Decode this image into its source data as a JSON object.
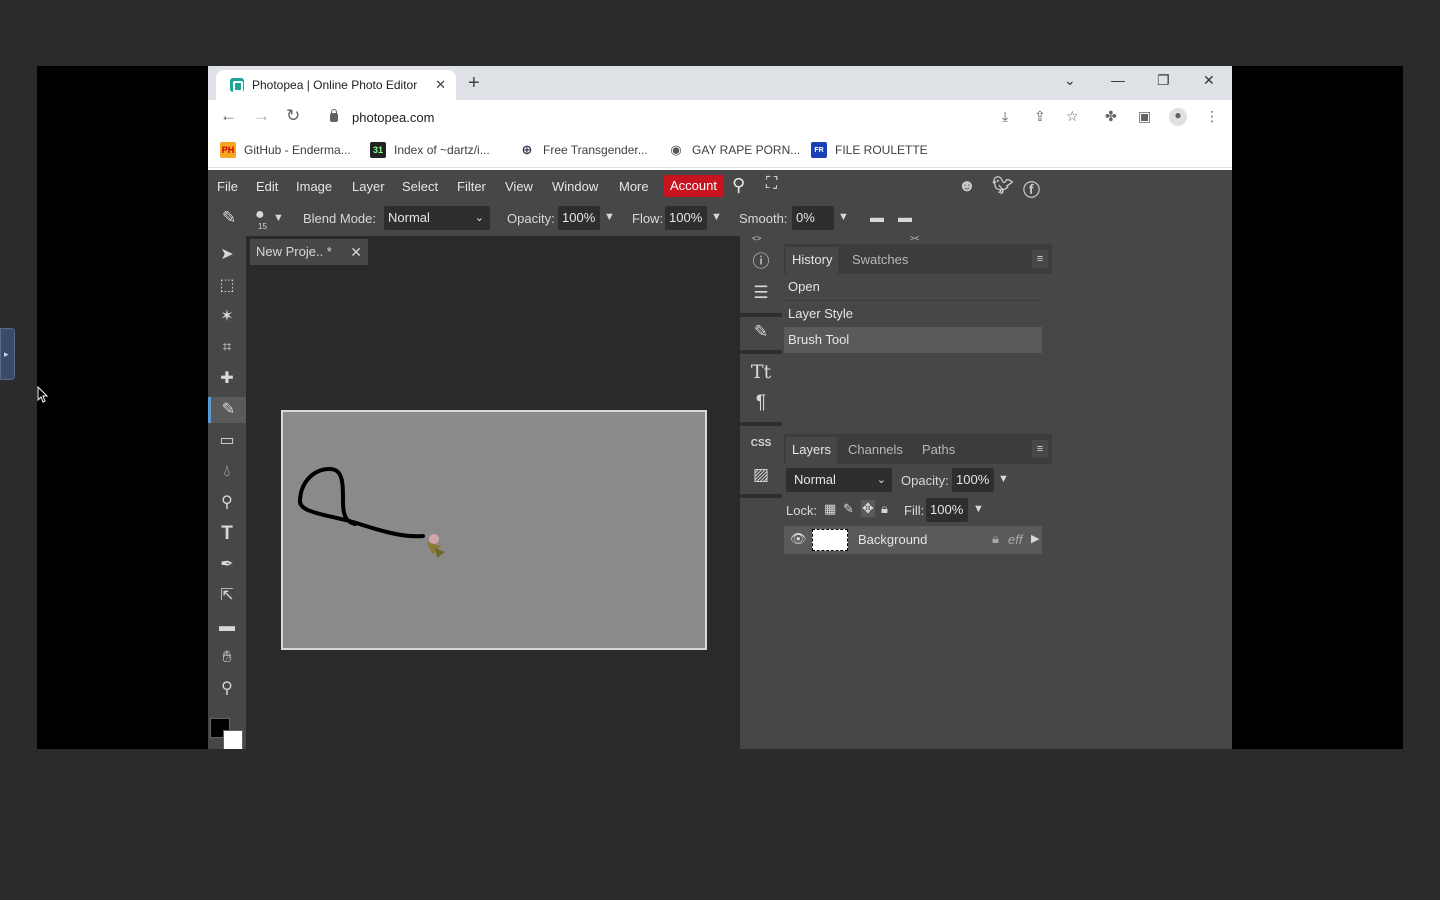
{
  "browser": {
    "tab_title": "Photopea | Online Photo Editor",
    "url": "photopea.com",
    "bookmarks": [
      {
        "label": "GitHub - Enderma...",
        "icon": "PH"
      },
      {
        "label": "Index of ~dartz/i...",
        "icon": "31"
      },
      {
        "label": "Free Transgender...",
        "icon": "globe"
      },
      {
        "label": "GAY RAPE PORN...",
        "icon": "globe"
      },
      {
        "label": "FILE ROULETTE",
        "icon": "FR"
      }
    ]
  },
  "menu": {
    "items": [
      "File",
      "Edit",
      "Image",
      "Layer",
      "Select",
      "Filter",
      "View",
      "Window",
      "More"
    ],
    "account": "Account"
  },
  "options": {
    "brush_size": "15",
    "blend_mode_label": "Blend Mode:",
    "blend_mode": "Normal",
    "opacity_label": "Opacity:",
    "opacity": "100%",
    "flow_label": "Flow:",
    "flow": "100%",
    "smooth_label": "Smooth:",
    "smooth": "0%"
  },
  "document": {
    "tab_title": "New Proje.. *"
  },
  "history_panel": {
    "tabs": [
      "History",
      "Swatches"
    ],
    "items": [
      "Open",
      "Layer Style",
      "Brush Tool"
    ]
  },
  "layers_panel": {
    "tabs": [
      "Layers",
      "Channels",
      "Paths"
    ],
    "blend_mode": "Normal",
    "opacity_label": "Opacity:",
    "opacity": "100%",
    "lock_label": "Lock:",
    "fill_label": "Fill:",
    "fill": "100%",
    "layers": [
      {
        "name": "Background",
        "eff": "eff"
      }
    ]
  },
  "mini": {
    "css_label": "CSS"
  },
  "colors": {
    "account_red": "#c8141e",
    "accent_blue": "#5b9bd5"
  }
}
